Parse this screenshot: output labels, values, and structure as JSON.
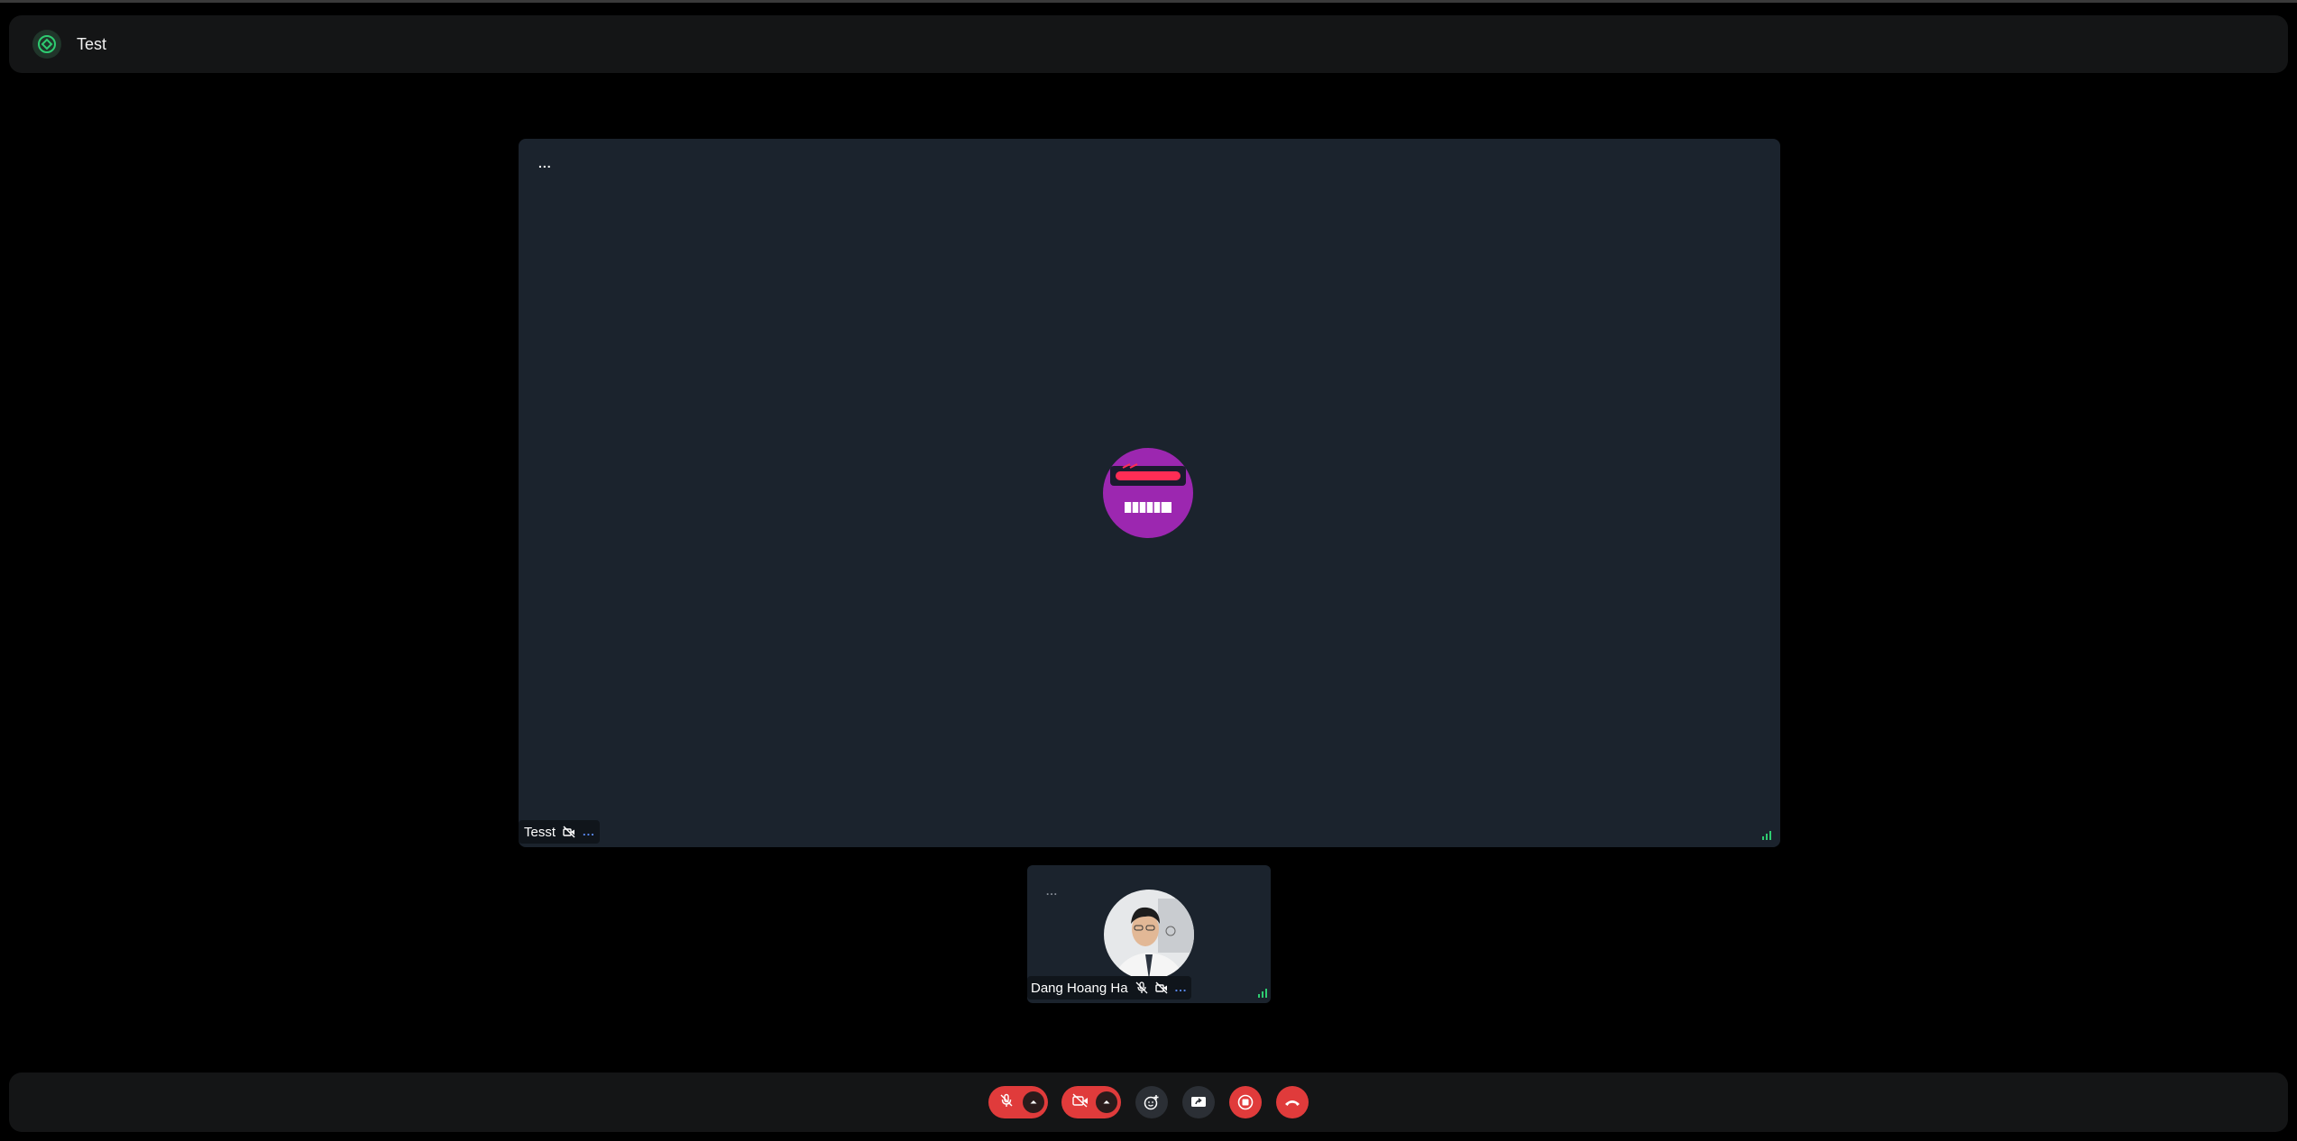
{
  "meeting": {
    "title": "Test"
  },
  "main_tile": {
    "participant_name": "Tesst",
    "menu_label": "...",
    "avatar_icon": "robot-face-avatar",
    "camera_off": true
  },
  "self_tile": {
    "participant_name": "Dang Hoang Ha",
    "menu_label": "...",
    "muted": true,
    "camera_off": true
  },
  "controls": {
    "mic": {
      "icon": "mic-off-icon",
      "state": "off"
    },
    "camera": {
      "icon": "video-off-icon",
      "state": "off"
    },
    "reactions": {
      "icon": "emoji-add-icon"
    },
    "screen_share": {
      "icon": "screen-share-icon"
    },
    "record": {
      "icon": "stop-record-icon"
    },
    "leave": {
      "icon": "hang-up-icon"
    }
  },
  "colors": {
    "background": "#000000",
    "panel": "#141516",
    "tile": "#1b232d",
    "danger": "#e03b3b",
    "accent_green": "#2ecc71",
    "accent_blue": "#5b8cff"
  }
}
